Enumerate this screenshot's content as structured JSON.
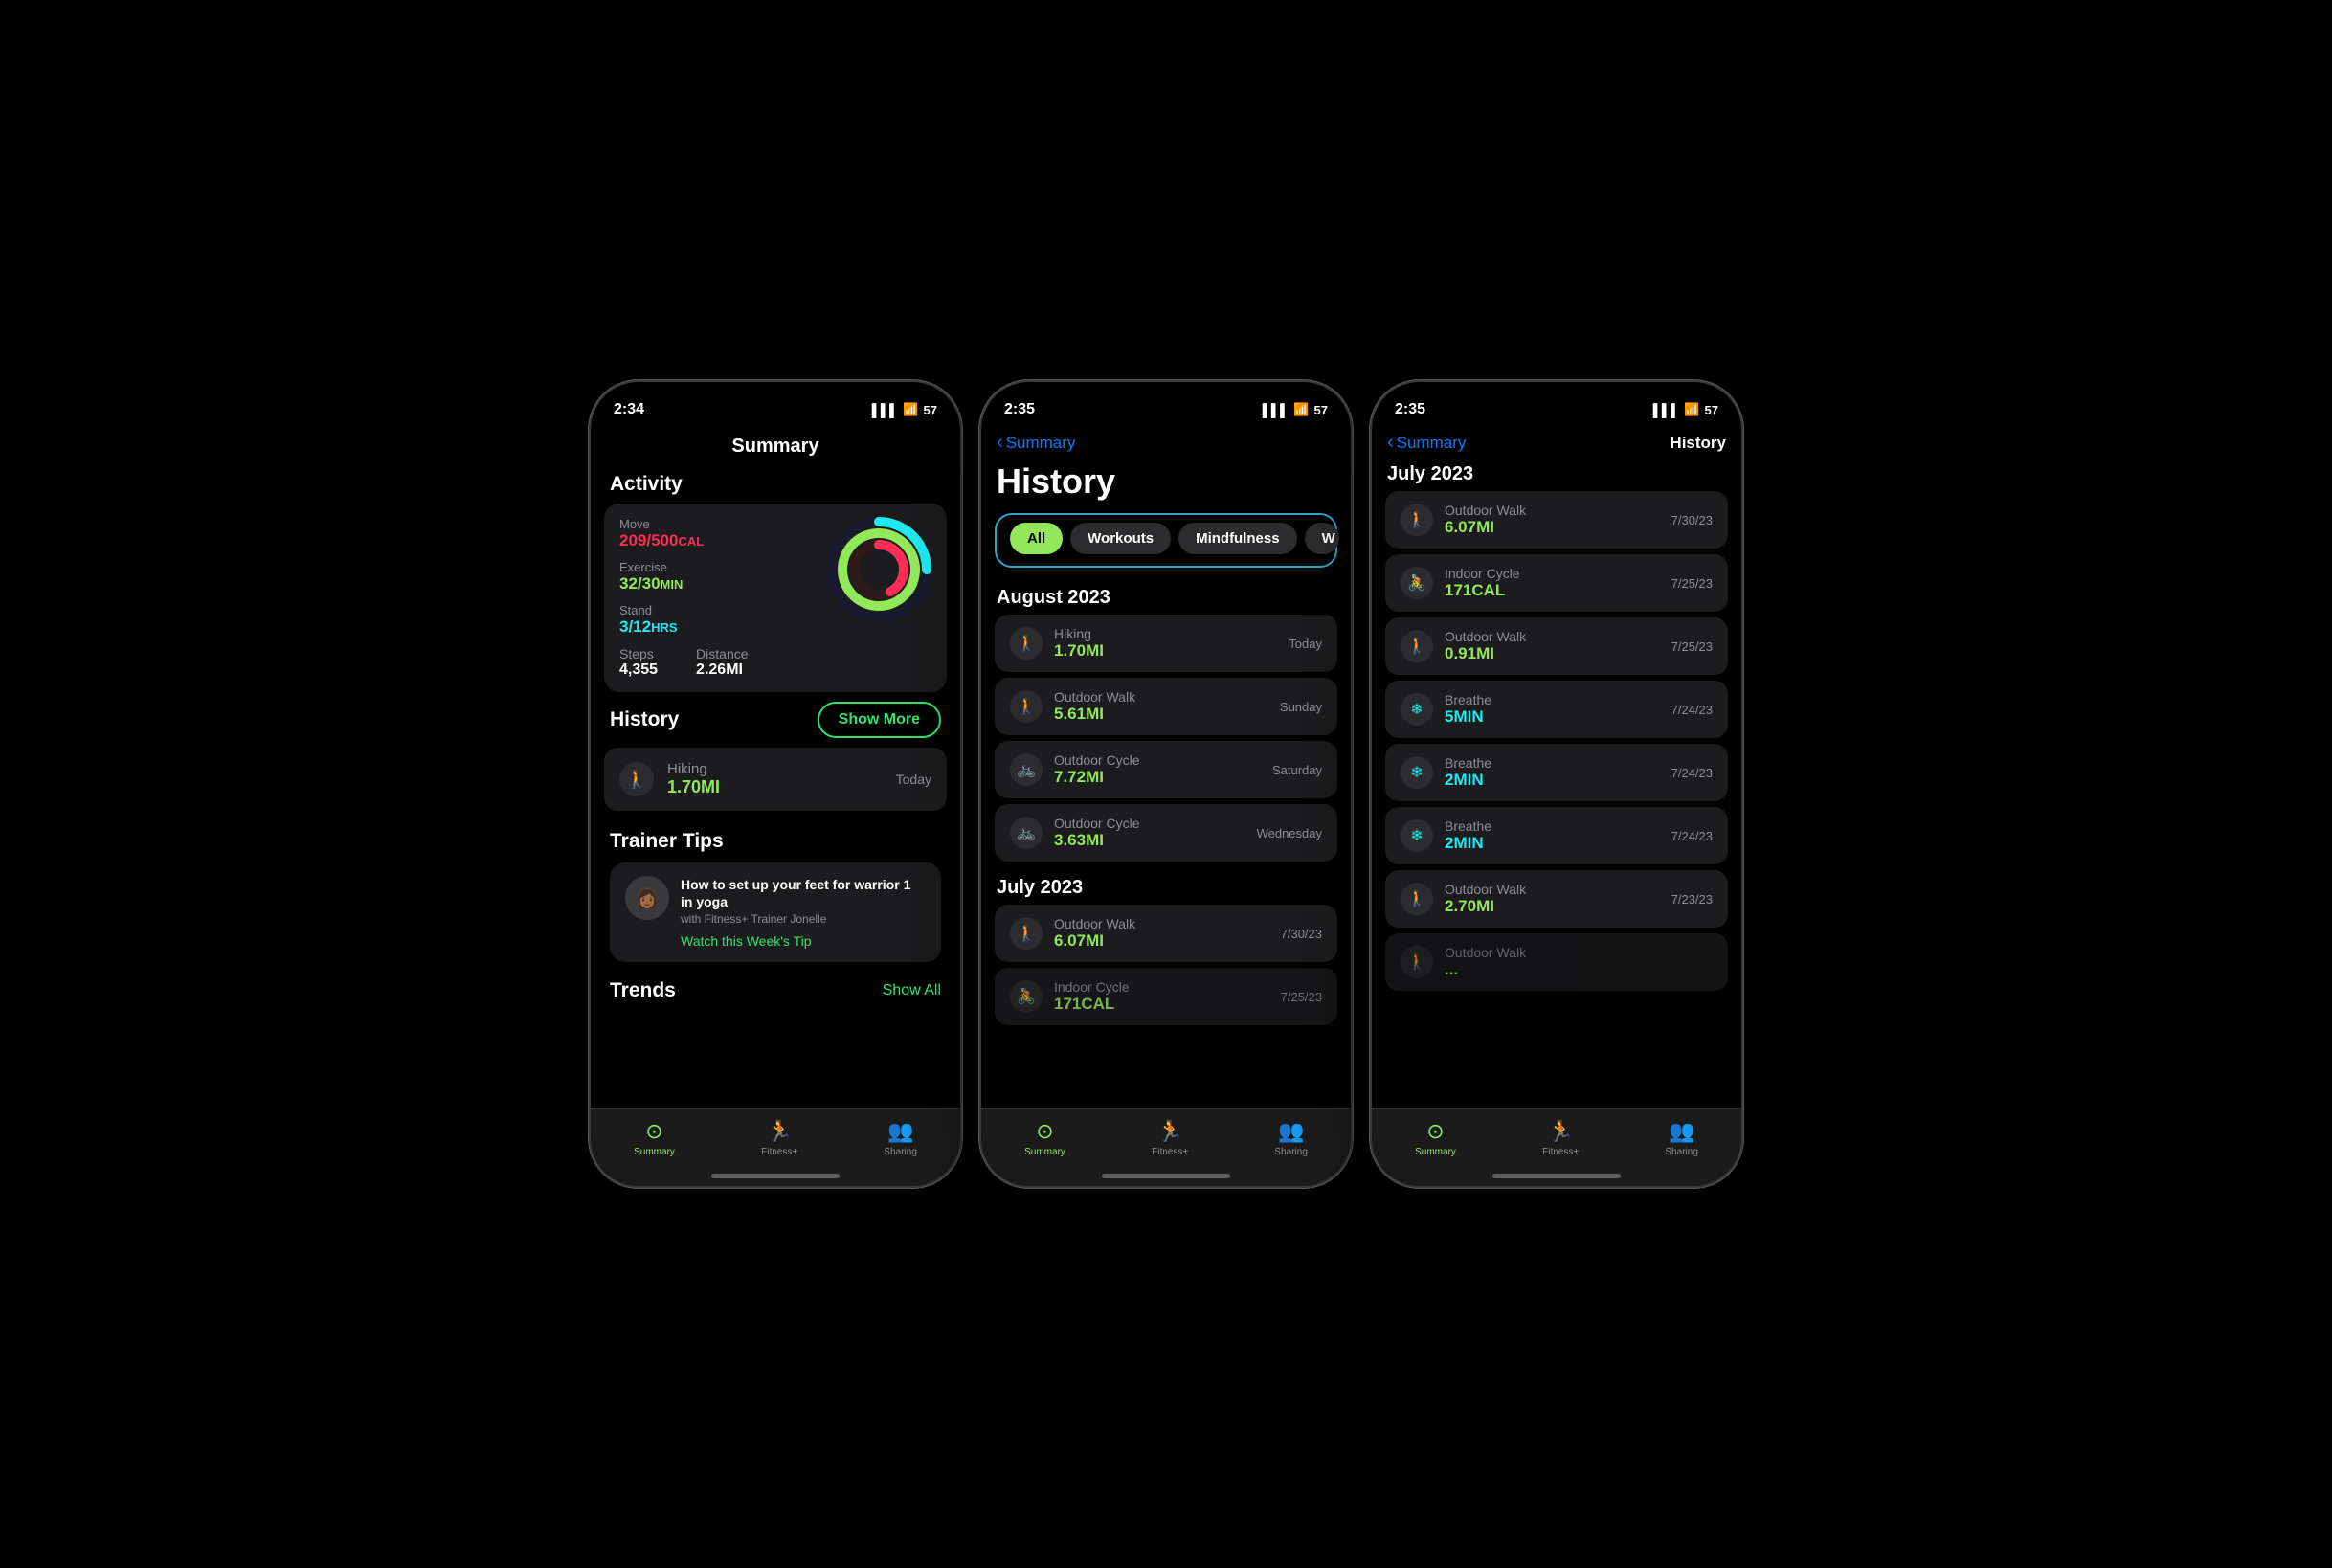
{
  "phone1": {
    "statusBar": {
      "time": "2:34",
      "signal": "▌▌▌",
      "wifi": "WiFi",
      "battery": "57"
    },
    "title": "Summary",
    "activity": {
      "sectionTitle": "Activity",
      "move": {
        "label": "Move",
        "value": "209/500",
        "unit": "CAL"
      },
      "exercise": {
        "label": "Exercise",
        "value": "32/30",
        "unit": "MIN"
      },
      "stand": {
        "label": "Stand",
        "value": "3/12",
        "unit": "HRS"
      },
      "steps": {
        "label": "Steps",
        "value": "4,355"
      },
      "distance": {
        "label": "Distance",
        "value": "2.26MI"
      },
      "rings": {
        "move": {
          "percent": 42,
          "color": "#fa2d55"
        },
        "exercise": {
          "percent": 110,
          "color": "#92e85a"
        },
        "stand": {
          "percent": 25,
          "color": "#1de9ef"
        }
      }
    },
    "history": {
      "sectionTitle": "History",
      "showMoreLabel": "Show More",
      "items": [
        {
          "icon": "🚶",
          "name": "Hiking",
          "value": "1.70MI",
          "date": "Today",
          "iconColor": "green"
        }
      ]
    },
    "trainerTips": {
      "sectionTitle": "Trainer Tips",
      "title": "How to set up your feet for warrior 1 in yoga",
      "subtitle": "with Fitness+ Trainer Jonelle",
      "watchLink": "Watch this Week's Tip"
    },
    "trends": {
      "sectionTitle": "Trends",
      "showAllLabel": "Show All"
    },
    "tabBar": {
      "tabs": [
        {
          "icon": "⊙",
          "label": "Summary",
          "active": true
        },
        {
          "icon": "♟",
          "label": "Fitness+",
          "active": false
        },
        {
          "icon": "👥",
          "label": "Sharing",
          "active": false
        }
      ]
    }
  },
  "phone2": {
    "statusBar": {
      "time": "2:35",
      "battery": "57"
    },
    "navBack": "Summary",
    "title": "History",
    "filterTabs": [
      {
        "label": "All",
        "active": true
      },
      {
        "label": "Workouts",
        "active": false
      },
      {
        "label": "Mindfulness",
        "active": false
      },
      {
        "label": "W",
        "active": false
      }
    ],
    "sections": [
      {
        "month": "August 2023",
        "items": [
          {
            "icon": "🚶",
            "iconColor": "green",
            "name": "Hiking",
            "value": "1.70MI",
            "valueColor": "green",
            "date": "Today"
          },
          {
            "icon": "🚶",
            "iconColor": "green",
            "name": "Outdoor Walk",
            "value": "5.61MI",
            "valueColor": "green",
            "date": "Sunday"
          },
          {
            "icon": "🚲",
            "iconColor": "green",
            "name": "Outdoor Cycle",
            "value": "7.72MI",
            "valueColor": "green",
            "date": "Saturday"
          },
          {
            "icon": "🚲",
            "iconColor": "green",
            "name": "Outdoor Cycle",
            "value": "3.63MI",
            "valueColor": "green",
            "date": "Wednesday"
          }
        ]
      },
      {
        "month": "July 2023",
        "items": [
          {
            "icon": "🚶",
            "iconColor": "green",
            "name": "Outdoor Walk",
            "value": "6.07MI",
            "valueColor": "green",
            "date": "7/30/23"
          },
          {
            "icon": "🚴",
            "iconColor": "green",
            "name": "Indoor Cycle",
            "value": "...",
            "valueColor": "green",
            "date": ""
          }
        ]
      }
    ],
    "tabBar": {
      "tabs": [
        {
          "icon": "⊙",
          "label": "Summary",
          "active": true
        },
        {
          "icon": "♟",
          "label": "Fitness+",
          "active": false
        },
        {
          "icon": "👥",
          "label": "Sharing",
          "active": false
        }
      ]
    }
  },
  "phone3": {
    "statusBar": {
      "time": "2:35",
      "battery": "57"
    },
    "navBack": "Summary",
    "navTitle": "History",
    "sections": [
      {
        "month": "July 2023",
        "items": [
          {
            "icon": "🚶",
            "iconColor": "green",
            "name": "Outdoor Walk",
            "value": "6.07MI",
            "valueColor": "green",
            "date": "7/30/23"
          },
          {
            "icon": "🚴",
            "iconColor": "green",
            "name": "Indoor Cycle",
            "value": "171CAL",
            "valueColor": "green",
            "date": "7/25/23"
          },
          {
            "icon": "🚶",
            "iconColor": "green",
            "name": "Outdoor Walk",
            "value": "0.91MI",
            "valueColor": "green",
            "date": "7/25/23"
          },
          {
            "icon": "❄",
            "iconColor": "teal",
            "name": "Breathe",
            "value": "5MIN",
            "valueColor": "teal",
            "date": "7/24/23"
          },
          {
            "icon": "❄",
            "iconColor": "teal",
            "name": "Breathe",
            "value": "2MIN",
            "valueColor": "teal",
            "date": "7/24/23"
          },
          {
            "icon": "❄",
            "iconColor": "teal",
            "name": "Breathe",
            "value": "2MIN",
            "valueColor": "teal",
            "date": "7/24/23"
          },
          {
            "icon": "🚶",
            "iconColor": "green",
            "name": "Outdoor Walk",
            "value": "2.70MI",
            "valueColor": "green",
            "date": "7/23/23"
          },
          {
            "icon": "🚶",
            "iconColor": "green",
            "name": "Outdoor Walk",
            "value": "...",
            "valueColor": "green",
            "date": ""
          }
        ]
      }
    ],
    "tabBar": {
      "tabs": [
        {
          "icon": "⊙",
          "label": "Summary",
          "active": true
        },
        {
          "icon": "♟",
          "label": "Fitness+",
          "active": false
        },
        {
          "icon": "👥",
          "label": "Sharing",
          "active": false
        }
      ]
    }
  }
}
